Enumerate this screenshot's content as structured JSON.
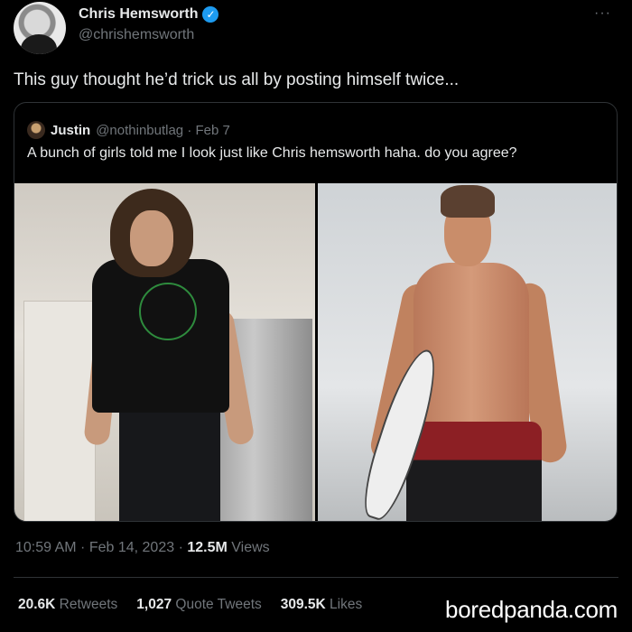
{
  "author": {
    "display_name": "Chris Hemsworth",
    "handle": "@chrishemsworth",
    "verified_icon": "verified-badge-icon"
  },
  "more_label": "···",
  "tweet": {
    "text": "This guy thought he’d trick us all by posting himself twice..."
  },
  "quote": {
    "display_name": "Justin",
    "handle_date": "@nothinbutlag · Feb 7",
    "text": "A bunch of girls told me I look just like Chris hemsworth haha. do you agree?"
  },
  "meta": {
    "time_date": "10:59 AM · Feb 14, 2023 · ",
    "views_count": "12.5M",
    "views_label": " Views"
  },
  "stats": {
    "retweets_count": "20.6K",
    "retweets_label": " Retweets",
    "quotes_count": "1,027",
    "quotes_label": " Quote Tweets",
    "likes_count": "309.5K",
    "likes_label": " Likes"
  },
  "watermark": "boredpanda.com",
  "colors": {
    "background": "#000000",
    "text": "#e7e9ea",
    "muted": "#71767b",
    "border": "#2f3336",
    "verified": "#1d9bf0"
  }
}
